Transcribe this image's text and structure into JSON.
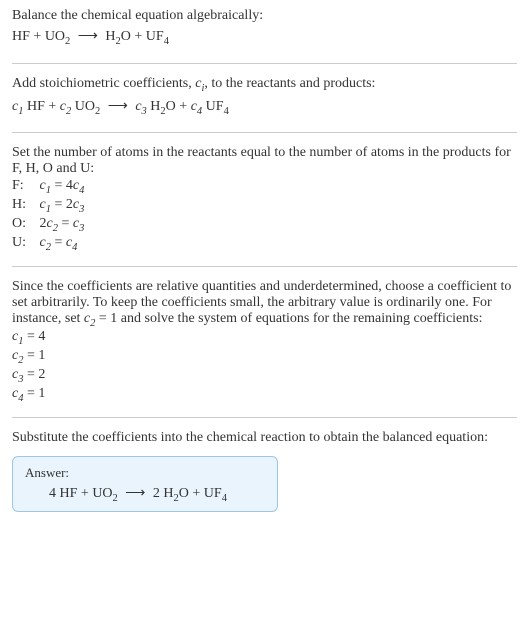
{
  "intro": {
    "line1": "Balance the chemical equation algebraically:"
  },
  "reaction_plain": {
    "lhs1": "HF",
    "plus": "+",
    "lhs2_a": "UO",
    "lhs2_sub": "2",
    "arrow": "⟶",
    "rhs1_a": "H",
    "rhs1_sub1": "2",
    "rhs1_b": "O",
    "rhs2_a": "UF",
    "rhs2_sub": "4"
  },
  "step_coeffs": {
    "text": "Add stoichiometric coefficients, ",
    "var": "c",
    "var_sub": "i",
    "text2": ", to the reactants and products:"
  },
  "reaction_coeffs": {
    "c1": "c",
    "c1s": "1",
    "r1": " HF",
    "plus": "+",
    "c2": "c",
    "c2s": "2",
    "r2a": " UO",
    "r2sub": "2",
    "arrow": "⟶",
    "c3": "c",
    "c3s": "3",
    "p1a": " H",
    "p1s1": "2",
    "p1b": "O",
    "c4": "c",
    "c4s": "4",
    "p2a": " UF",
    "p2sub": "4"
  },
  "atoms_intro": {
    "line1": "Set the number of atoms in the reactants equal to the number of atoms in the products for F, H, O and U:"
  },
  "atoms": {
    "F": {
      "label": "F:",
      "eq_l_c": "c",
      "eq_l_s": "1",
      "eq_mid": " = 4",
      "eq_r_c": "c",
      "eq_r_s": "4"
    },
    "H": {
      "label": "H:",
      "eq_l_c": "c",
      "eq_l_s": "1",
      "eq_mid": " = 2",
      "eq_r_c": "c",
      "eq_r_s": "3"
    },
    "O": {
      "label": "O:",
      "eq_l_pre": "2",
      "eq_l_c": "c",
      "eq_l_s": "2",
      "eq_mid": " = ",
      "eq_r_c": "c",
      "eq_r_s": "3"
    },
    "U": {
      "label": "U:",
      "eq_l_c": "c",
      "eq_l_s": "2",
      "eq_mid": " = ",
      "eq_r_c": "c",
      "eq_r_s": "4"
    }
  },
  "choose": {
    "t1": "Since the coefficients are relative quantities and underdetermined, choose a coefficient to set arbitrarily. To keep the coefficients small, the arbitrary value is ordinarily one. For instance, set ",
    "cv": "c",
    "cvs": "2",
    "t2": " = 1 and solve the system of equations for the remaining coefficients:"
  },
  "solved": {
    "c1": {
      "c": "c",
      "s": "1",
      "eq": " = 4"
    },
    "c2": {
      "c": "c",
      "s": "2",
      "eq": " = 1"
    },
    "c3": {
      "c": "c",
      "s": "3",
      "eq": " = 2"
    },
    "c4": {
      "c": "c",
      "s": "4",
      "eq": " = 1"
    }
  },
  "subst": {
    "text": "Substitute the coefficients into the chemical reaction to obtain the balanced equation:"
  },
  "answer": {
    "label": "Answer:",
    "n1": "4 ",
    "r1": "HF",
    "plus": "+",
    "r2a": "UO",
    "r2s": "2",
    "arrow": "⟶",
    "n3": "2 ",
    "p1a": "H",
    "p1s1": "2",
    "p1b": "O",
    "p2a": "UF",
    "p2s": "4"
  },
  "chart_data": {
    "type": "table",
    "title": "Balanced chemical equation coefficients",
    "coefficients": {
      "c1": 4,
      "c2": 1,
      "c3": 2,
      "c4": 1
    },
    "atom_balance": [
      {
        "element": "F",
        "lhs": "c1",
        "rhs": "4*c4"
      },
      {
        "element": "H",
        "lhs": "c1",
        "rhs": "2*c3"
      },
      {
        "element": "O",
        "lhs": "2*c2",
        "rhs": "c3"
      },
      {
        "element": "U",
        "lhs": "c2",
        "rhs": "c4"
      }
    ],
    "balanced_equation": "4 HF + UO2 ⟶ 2 H2O + UF4"
  }
}
